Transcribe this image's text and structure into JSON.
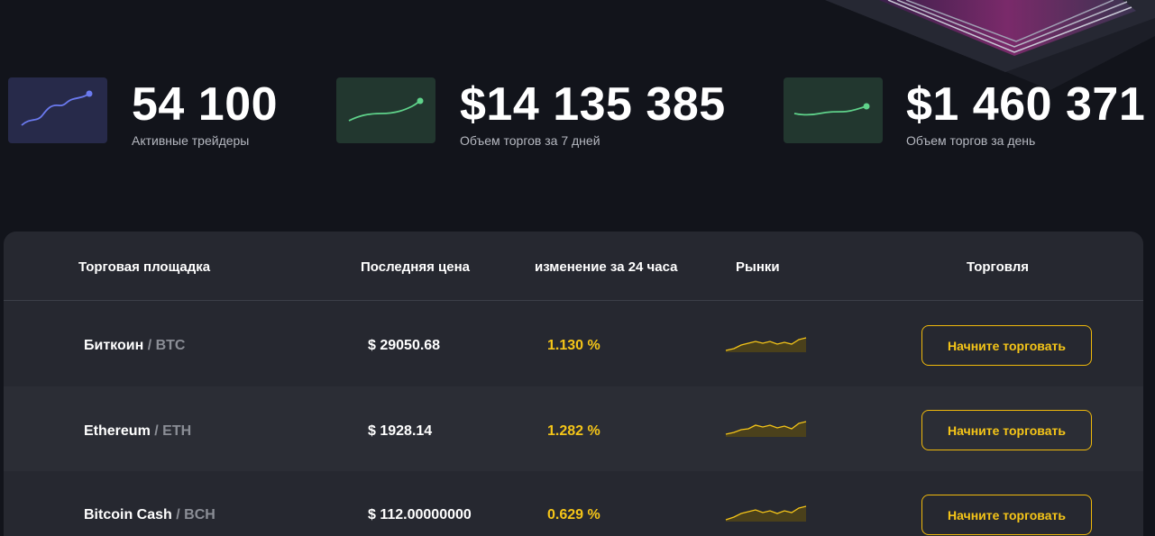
{
  "stats": [
    {
      "value": "54 100",
      "label": "Активные трейдеры",
      "icon": "trend-chart-icon",
      "color": "#6b7af0"
    },
    {
      "value": "$14 135 385",
      "label": "Объем торгов за 7 дней",
      "icon": "trend-chart-icon",
      "color": "#5fd28a"
    },
    {
      "value": "$1 460 371",
      "label": "Объем торгов за день",
      "icon": "trend-chart-icon",
      "color": "#5fd28a"
    }
  ],
  "table": {
    "headers": {
      "platform": "Торговая площадка",
      "price": "Последняя цена",
      "change": "изменение за 24 часа",
      "markets": "Рынки",
      "trade": "Торговля"
    },
    "rows": [
      {
        "name": "Биткоин",
        "ticker": "/ BTC",
        "price": "$ 29050.68",
        "change": "1.130 %",
        "button": "Начните торговать"
      },
      {
        "name": "Ethereum",
        "ticker": "/ ETH",
        "price": "$ 1928.14",
        "change": "1.282 %",
        "button": "Начните торговать"
      },
      {
        "name": "Bitcoin Cash",
        "ticker": "/ BCH",
        "price": "$ 112.00000000",
        "change": "0.629 %",
        "button": "Начните торговать"
      }
    ]
  },
  "colors": {
    "accent": "#f5c518",
    "background": "#12141b",
    "panel": "#262830"
  }
}
